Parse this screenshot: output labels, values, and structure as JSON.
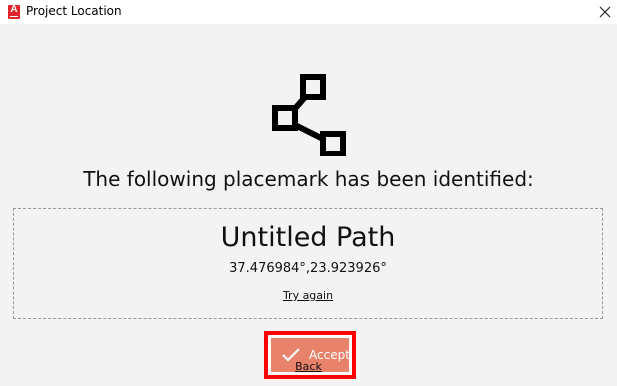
{
  "window": {
    "title": "Project Location",
    "app_icon_letter": "A",
    "accent_color": "#e0262b"
  },
  "dialog": {
    "icon": "path-nodes-icon",
    "heading": "The following placemark has been identified:",
    "placemark": {
      "name": "Untitled Path",
      "coordinates": "37.476984°,23.923926°"
    },
    "try_again_label": "Try again",
    "accept_label": "Accept",
    "accept_color": "#e8826a",
    "highlight_color": "#ff0000",
    "back_label": "Back"
  }
}
